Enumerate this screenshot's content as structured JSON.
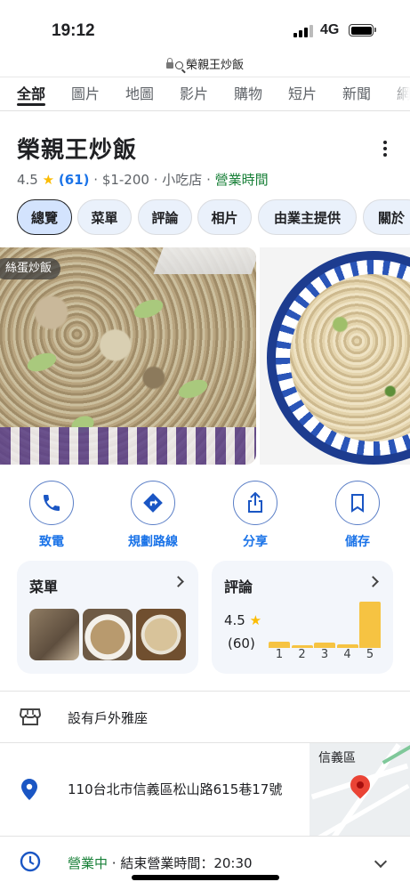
{
  "status_bar": {
    "time": "19:12",
    "network": "4G"
  },
  "url_bar": {
    "text": "榮親王炒飯"
  },
  "tabs": [
    {
      "label": "全部",
      "active": true
    },
    {
      "label": "圖片"
    },
    {
      "label": "地圖"
    },
    {
      "label": "影片"
    },
    {
      "label": "購物"
    },
    {
      "label": "短片"
    },
    {
      "label": "新聞"
    },
    {
      "label": "網"
    }
  ],
  "place": {
    "name": "榮親王炒飯",
    "rating": "4.5",
    "star": "★",
    "review_count": "(61)",
    "sep": "·",
    "price": "$1-200",
    "category": "小吃店",
    "hours_link": "營業時間"
  },
  "chips": [
    {
      "label": "總覽",
      "active": true
    },
    {
      "label": "菜單"
    },
    {
      "label": "評論"
    },
    {
      "label": "相片"
    },
    {
      "label": "由業主提供"
    },
    {
      "label": "關於"
    }
  ],
  "photos": {
    "tag": "絲蛋炒飯"
  },
  "actions": [
    {
      "label": "致電",
      "icon": "phone-icon"
    },
    {
      "label": "規劃路線",
      "icon": "directions-icon"
    },
    {
      "label": "分享",
      "icon": "share-icon"
    },
    {
      "label": "儲存",
      "icon": "bookmark-icon"
    }
  ],
  "menu_card": {
    "title": "菜單"
  },
  "reviews_card": {
    "title": "評論",
    "rating": "4.5",
    "star": "★",
    "count": "(60)",
    "distribution": [
      {
        "stars": "1",
        "share": 0.12
      },
      {
        "stars": "2",
        "share": 0.05
      },
      {
        "stars": "3",
        "share": 0.1
      },
      {
        "stars": "4",
        "share": 0.08
      },
      {
        "stars": "5",
        "share": 0.92
      }
    ]
  },
  "info": {
    "outdoor": "設有戶外雅座",
    "address": "110台北市信義區松山路615巷17號",
    "map_label": "信義區",
    "open_status": "營業中",
    "closing": "· 結束營業時間：20:30"
  },
  "colors": {
    "accent": "#1a73e8",
    "open": "#188038",
    "star": "#fbbc04",
    "bar": "#f6c342"
  }
}
